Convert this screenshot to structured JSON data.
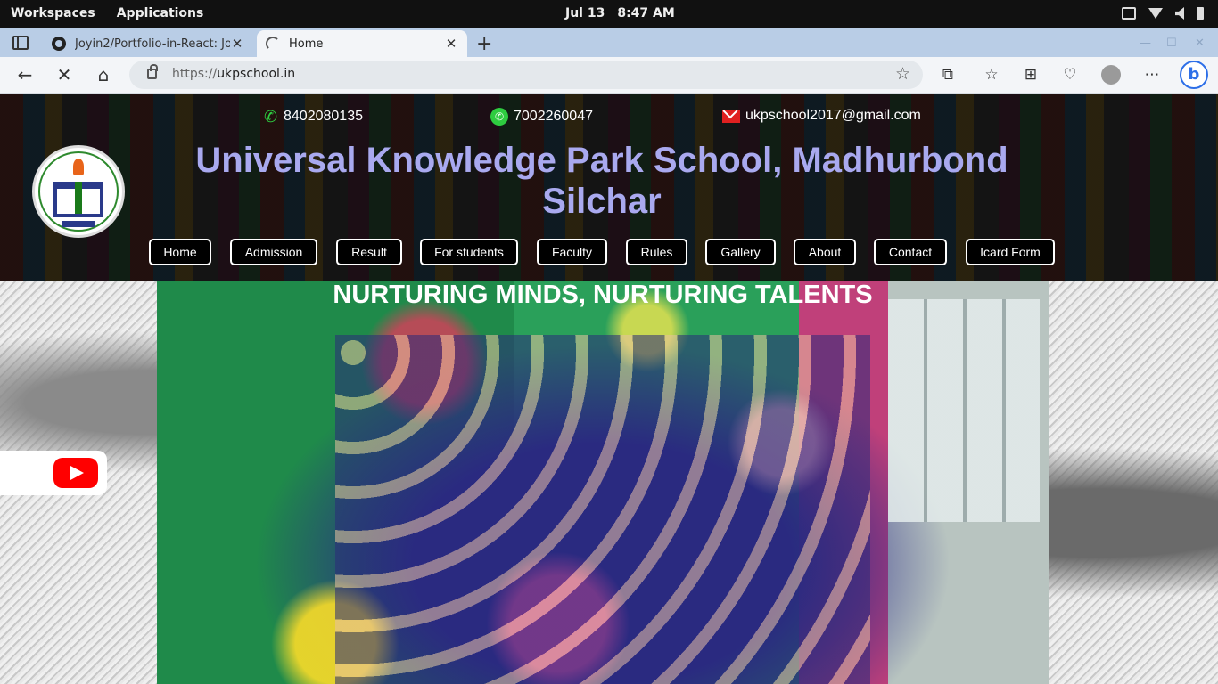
{
  "os": {
    "workspaces": "Workspaces",
    "applications": "Applications",
    "date": "Jul 13",
    "time": "8:47 AM"
  },
  "browser": {
    "tabs": [
      {
        "title": "Joyin2/Portfolio-in-React: Joy",
        "icon": "github-icon"
      },
      {
        "title": "Home",
        "icon": "loading-icon"
      }
    ],
    "new_tab": "+",
    "url_scheme": "https://",
    "url_host": "ukpschool.in"
  },
  "site": {
    "phone": "8402080135",
    "whatsapp": "7002260047",
    "email": "ukpschool2017@gmail.com",
    "title_line1": "Universal Knowledge Park School, Madhurbond",
    "title_line2": "Silchar",
    "menu": [
      "Home",
      "Admission",
      "Result",
      "For students",
      "Faculty",
      "Rules",
      "Gallery",
      "About",
      "Contact",
      "Icard Form"
    ],
    "tagline": "NURTURING MINDS, NURTURING TALENTS",
    "title_color": "#a9a9ef"
  }
}
